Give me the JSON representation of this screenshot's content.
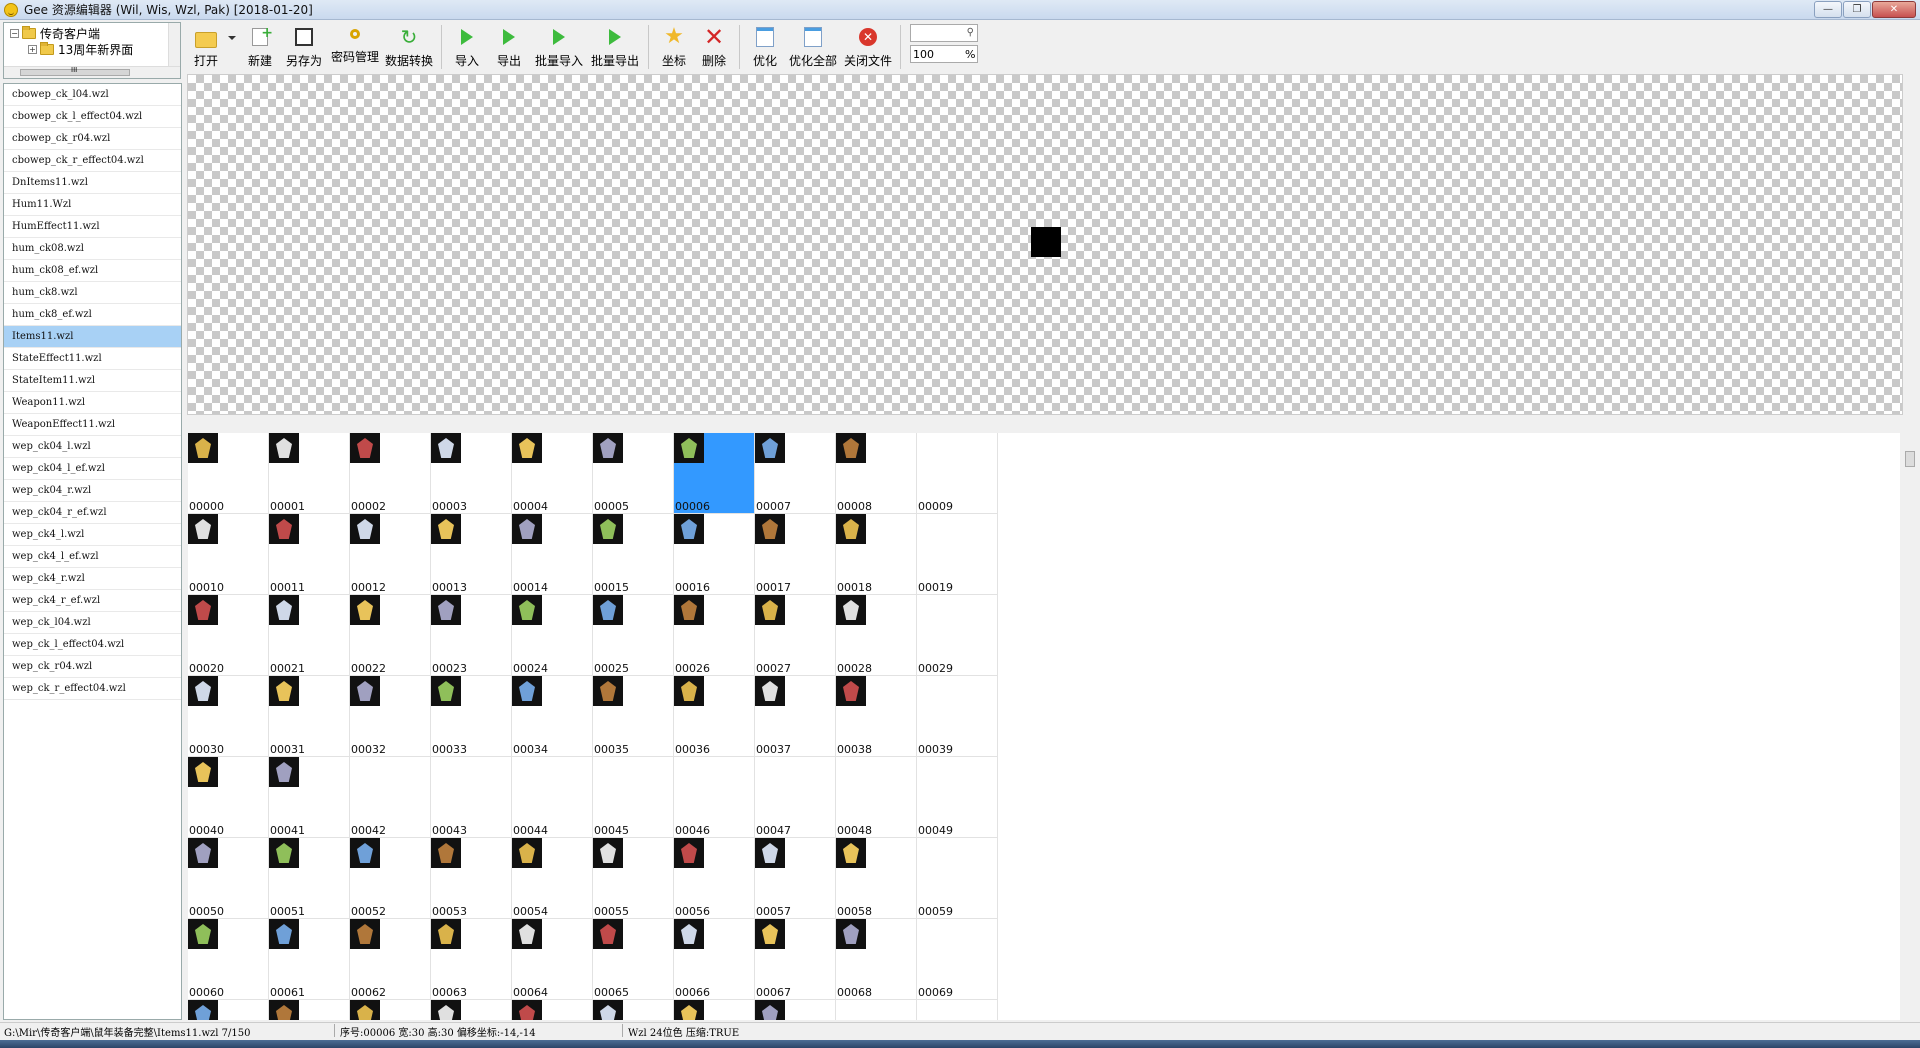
{
  "window": {
    "title": "Gee 资源编辑器 (Wil, Wis, Wzl, Pak) [2018-01-20]"
  },
  "tree": {
    "root_label": "传奇客户端",
    "child_label": "13周年新界面",
    "hscroll_mark": "III"
  },
  "toolbar": {
    "open": "打开",
    "new": "新建",
    "save_as": "另存为",
    "password": "密码管理",
    "convert": "数据转换",
    "import": "导入",
    "export": "导出",
    "batch_import": "批量导入",
    "batch_export": "批量导出",
    "coords": "坐标",
    "delete": "删除",
    "optimize": "优化",
    "optimize_all": "优化全部",
    "close_file": "关闭文件",
    "search_value": "",
    "zoom_value": "100",
    "zoom_unit": "%"
  },
  "files": [
    "cbowep_ck_l04.wzl",
    "cbowep_ck_l_effect04.wzl",
    "cbowep_ck_r04.wzl",
    "cbowep_ck_r_effect04.wzl",
    "DnItems11.wzl",
    "Hum11.Wzl",
    "HumEffect11.wzl",
    "hum_ck08.wzl",
    "hum_ck08_ef.wzl",
    "hum_ck8.wzl",
    "hum_ck8_ef.wzl",
    "Items11.wzl",
    "StateEffect11.wzl",
    "StateItem11.wzl",
    "Weapon11.wzl",
    "WeaponEffect11.wzl",
    "wep_ck04_l.wzl",
    "wep_ck04_l_ef.wzl",
    "wep_ck04_r.wzl",
    "wep_ck04_r_ef.wzl",
    "wep_ck4_l.wzl",
    "wep_ck4_l_ef.wzl",
    "wep_ck4_r.wzl",
    "wep_ck4_r_ef.wzl",
    "wep_ck_l04.wzl",
    "wep_ck_l_effect04.wzl",
    "wep_ck_r04.wzl",
    "wep_ck_r_effect04.wzl"
  ],
  "selected_file": "Items11.wzl",
  "grid": {
    "selected_index": 6,
    "rows": [
      [
        "00000",
        "00001",
        "00002",
        "00003",
        "00004",
        "00005",
        "00006",
        "00007",
        "00008",
        "00009"
      ],
      [
        "00010",
        "00011",
        "00012",
        "00013",
        "00014",
        "00015",
        "00016",
        "00017",
        "00018",
        "00019"
      ],
      [
        "00020",
        "00021",
        "00022",
        "00023",
        "00024",
        "00025",
        "00026",
        "00027",
        "00028",
        "00029"
      ],
      [
        "00030",
        "00031",
        "00032",
        "00033",
        "00034",
        "00035",
        "00036",
        "00037",
        "00038",
        "00039"
      ],
      [
        "00040",
        "00041",
        "00042",
        "00043",
        "00044",
        "00045",
        "00046",
        "00047",
        "00048",
        "00049"
      ],
      [
        "00050",
        "00051",
        "00052",
        "00053",
        "00054",
        "00055",
        "00056",
        "00057",
        "00058",
        "00059"
      ],
      [
        "00060",
        "00061",
        "00062",
        "00063",
        "00064",
        "00065",
        "00066",
        "00067",
        "00068",
        "00069"
      ],
      [
        "",
        "",
        "",
        "",
        "",
        "",
        "",
        "",
        "",
        ""
      ]
    ],
    "filled_per_row": [
      9,
      9,
      9,
      9,
      2,
      9,
      9,
      8
    ]
  },
  "status": {
    "path": "G:\\Mir\\传奇客户端\\鼠年装备完整\\Items11.wzl 7/150",
    "info": "序号:00006 宽:30 高:30 偏移坐标:-14,-14",
    "format": "Wzl 24位色 压缩:TRUE"
  },
  "colors": {
    "selection_blue": "#3399ff",
    "list_selection": "#a8d1f5",
    "checker": "#c9c9c9"
  }
}
